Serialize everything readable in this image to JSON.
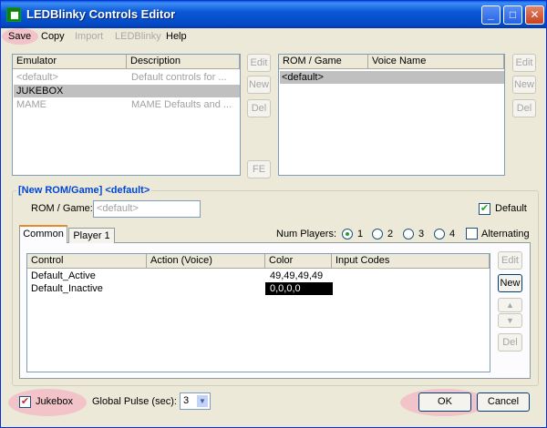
{
  "window": {
    "title": "LEDBlinky Controls Editor",
    "buttons": {
      "minimize": "_",
      "maximize": "□",
      "close": "✕"
    }
  },
  "menu": [
    {
      "label": "Save",
      "disabled": false
    },
    {
      "label": "Copy",
      "disabled": false
    },
    {
      "label": "Import",
      "disabled": true
    },
    {
      "label": "LEDBlinky",
      "disabled": true
    },
    {
      "label": "Help",
      "disabled": false
    }
  ],
  "emulator_list": {
    "columns": [
      "Emulator",
      "Description"
    ],
    "rows": [
      {
        "emulator": "<default>",
        "description": "Default controls for ...",
        "state": "dim"
      },
      {
        "emulator": "JUKEBOX",
        "description": "",
        "state": "selected"
      },
      {
        "emulator": "MAME",
        "description": "MAME Defaults and ...",
        "state": "dim"
      }
    ],
    "buttons": {
      "edit": "Edit",
      "new": "New",
      "del": "Del",
      "fe": "FE"
    }
  },
  "rom_list": {
    "columns": [
      "ROM / Game",
      "Voice Name"
    ],
    "rows": [
      {
        "rom": "<default>",
        "voice": "",
        "state": "selected"
      }
    ],
    "buttons": {
      "edit": "Edit",
      "new": "New",
      "del": "Del"
    }
  },
  "rom_group": {
    "title": "[New ROM/Game] <default>",
    "rom_label": "ROM / Game:",
    "rom_placeholder": "<default>",
    "default_label": "Default",
    "default_checked": true
  },
  "tabs": {
    "items": [
      {
        "label": "Common",
        "active": true
      },
      {
        "label": "Player 1",
        "active": false
      }
    ]
  },
  "num_players": {
    "label": "Num Players:",
    "options": [
      "1",
      "2",
      "3",
      "4"
    ],
    "selected": "1",
    "alternating_label": "Alternating",
    "alternating_checked": false
  },
  "controls_table": {
    "columns": [
      "Control",
      "Action (Voice)",
      "Color",
      "Input Codes"
    ],
    "rows": [
      {
        "control": "Default_Active",
        "action": "",
        "color": "49,49,49,49",
        "input": "",
        "color_selected": false
      },
      {
        "control": "Default_Inactive",
        "action": "",
        "color": "0,0,0,0",
        "input": "",
        "color_selected": true
      }
    ],
    "buttons": {
      "edit": "Edit",
      "new": "New",
      "up": "▲",
      "down": "▼",
      "del": "Del"
    }
  },
  "footer": {
    "jukebox_label": "Jukebox",
    "jukebox_checked": true,
    "pulse_label": "Global Pulse (sec):",
    "pulse_value": "3",
    "ok_label": "OK",
    "cancel_label": "Cancel"
  }
}
